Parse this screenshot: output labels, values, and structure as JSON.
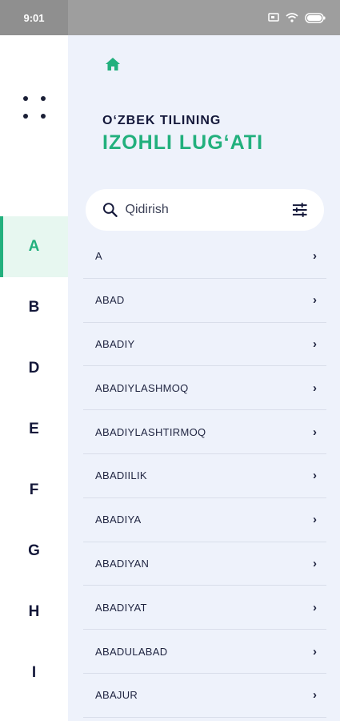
{
  "status": {
    "time": "9:01"
  },
  "header": {
    "subtitle": "O‘ZBEK TILINING",
    "title": "IZOHLI LUG‘ATI"
  },
  "search": {
    "placeholder": "Qidirish",
    "value": ""
  },
  "letters": [
    "A",
    "B",
    "D",
    "E",
    "F",
    "G",
    "H",
    "I"
  ],
  "active_letter": "A",
  "words": [
    "A",
    "ABAD",
    "ABADIY",
    "ABADIYLASHMOQ",
    "ABADIYLASHTIRMOQ",
    "ABADIILIK",
    "ABADIYA",
    "ABADIYAN",
    "ABADIYAT",
    "ABADULABAD",
    "ABAJUR"
  ],
  "icons": {
    "home": "home-icon",
    "menu": "menu-dots-icon",
    "search": "search-icon",
    "filter": "sliders-icon",
    "chevron": "chevron-right-icon"
  },
  "colors": {
    "accent": "#22b07d",
    "dark": "#14183a",
    "panel": "#eef2fb"
  }
}
